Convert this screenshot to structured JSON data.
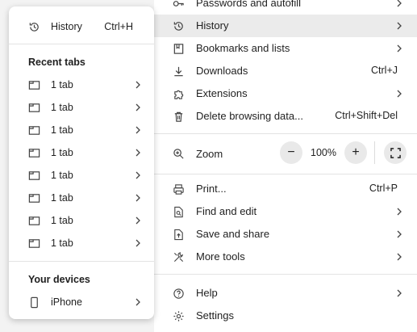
{
  "main_menu": {
    "passwords": {
      "label": "Passwords and autofill",
      "icon": "key-icon"
    },
    "history": {
      "label": "History",
      "icon": "history-icon"
    },
    "bookmarks": {
      "label": "Bookmarks and lists",
      "icon": "bookmark-icon"
    },
    "downloads": {
      "label": "Downloads",
      "shortcut": "Ctrl+J",
      "icon": "download-icon"
    },
    "extensions": {
      "label": "Extensions",
      "icon": "puzzle-icon"
    },
    "delete_data": {
      "label": "Delete browsing data...",
      "shortcut": "Ctrl+Shift+Del",
      "icon": "trash-icon"
    },
    "zoom": {
      "label": "Zoom",
      "value": "100%",
      "minus": "−",
      "plus": "+",
      "icon": "zoom-icon"
    },
    "print": {
      "label": "Print...",
      "shortcut": "Ctrl+P",
      "icon": "printer-icon"
    },
    "find_edit": {
      "label": "Find and edit",
      "icon": "find-page-icon"
    },
    "save_share": {
      "label": "Save and share",
      "icon": "save-share-icon"
    },
    "more_tools": {
      "label": "More tools",
      "icon": "tools-icon"
    },
    "help": {
      "label": "Help",
      "icon": "help-icon"
    },
    "settings": {
      "label": "Settings",
      "icon": "gear-icon"
    }
  },
  "history_submenu": {
    "history": {
      "label": "History",
      "shortcut": "Ctrl+H"
    },
    "recent_tabs_heading": "Recent tabs",
    "recent_tabs": [
      "1 tab",
      "1 tab",
      "1 tab",
      "1 tab",
      "1 tab",
      "1 tab",
      "1 tab",
      "1 tab"
    ],
    "devices_heading": "Your devices",
    "device": {
      "label": "iPhone"
    }
  },
  "colors": {
    "highlight": "#ebebeb",
    "menu_bg": "#ffffff",
    "page_bg": "#f3f3f3"
  }
}
